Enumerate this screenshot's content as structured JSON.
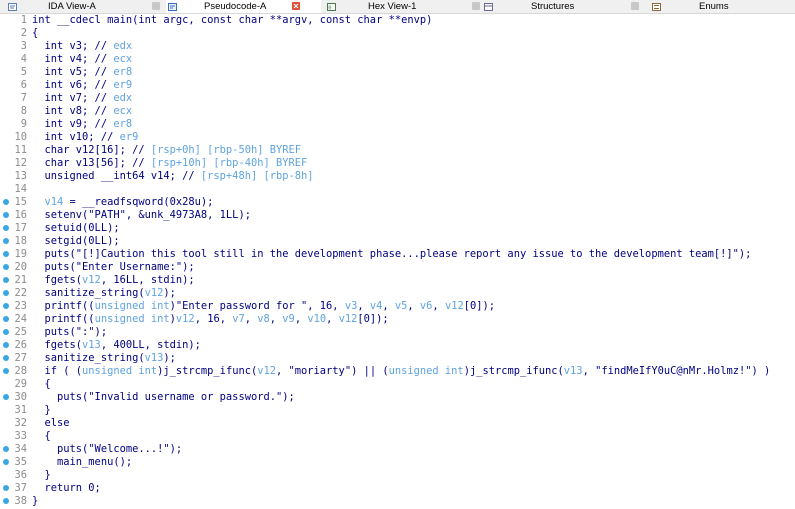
{
  "tabs": [
    {
      "label": "IDA View-A",
      "icon": "disassembly-icon",
      "active": false
    },
    {
      "label": "Pseudocode-A",
      "icon": "pseudocode-icon",
      "active": true
    },
    {
      "label": "Hex View-1",
      "icon": "hex-icon",
      "active": false
    },
    {
      "label": "Structures",
      "icon": "structures-icon",
      "active": false
    },
    {
      "label": "Enums",
      "icon": "enums-icon",
      "active": false
    }
  ],
  "colors": {
    "code_text": "#00007f",
    "comment": "#5fa3e0",
    "line_number": "#8c8c8c",
    "breakpoint_dot": "#3ba6e6",
    "close_button": "#e05030"
  },
  "code_lines": [
    {
      "n": "1",
      "dot": false,
      "parts": [
        [
          "int __cdecl main(int argc, const char **argv, const char **envp)",
          "t"
        ]
      ]
    },
    {
      "n": "2",
      "dot": false,
      "parts": [
        [
          "{",
          "t"
        ]
      ]
    },
    {
      "n": "3",
      "dot": false,
      "parts": [
        [
          "  int v3; // ",
          "t"
        ],
        [
          "edx",
          "c"
        ]
      ]
    },
    {
      "n": "4",
      "dot": false,
      "parts": [
        [
          "  int v4; // ",
          "t"
        ],
        [
          "ecx",
          "c"
        ]
      ]
    },
    {
      "n": "5",
      "dot": false,
      "parts": [
        [
          "  int v5; // ",
          "t"
        ],
        [
          "er8",
          "c"
        ]
      ]
    },
    {
      "n": "6",
      "dot": false,
      "parts": [
        [
          "  int v6; // ",
          "t"
        ],
        [
          "er9",
          "c"
        ]
      ]
    },
    {
      "n": "7",
      "dot": false,
      "parts": [
        [
          "  int v7; // ",
          "t"
        ],
        [
          "edx",
          "c"
        ]
      ]
    },
    {
      "n": "8",
      "dot": false,
      "parts": [
        [
          "  int v8; // ",
          "t"
        ],
        [
          "ecx",
          "c"
        ]
      ]
    },
    {
      "n": "9",
      "dot": false,
      "parts": [
        [
          "  int v9; // ",
          "t"
        ],
        [
          "er8",
          "c"
        ]
      ]
    },
    {
      "n": "10",
      "dot": false,
      "parts": [
        [
          "  int v10; // ",
          "t"
        ],
        [
          "er9",
          "c"
        ]
      ]
    },
    {
      "n": "11",
      "dot": false,
      "parts": [
        [
          "  char v12[16]; // ",
          "t"
        ],
        [
          "[rsp+0h] [rbp-50h] BYREF",
          "c"
        ]
      ]
    },
    {
      "n": "12",
      "dot": false,
      "parts": [
        [
          "  char v13[56]; // ",
          "t"
        ],
        [
          "[rsp+10h] [rbp-40h] BYREF",
          "c"
        ]
      ]
    },
    {
      "n": "13",
      "dot": false,
      "parts": [
        [
          "  unsigned __int64 v14; // ",
          "t"
        ],
        [
          "[rsp+48h] [rbp-8h]",
          "c"
        ]
      ]
    },
    {
      "n": "14",
      "dot": false,
      "parts": [
        [
          "",
          "t"
        ]
      ]
    },
    {
      "n": "15",
      "dot": true,
      "parts": [
        [
          "  ",
          "t"
        ],
        [
          "v14",
          "c"
        ],
        [
          " = __readfsqword(0x28u);",
          "t"
        ]
      ]
    },
    {
      "n": "16",
      "dot": true,
      "parts": [
        [
          "  setenv(\"PATH\", &unk_4973A8, 1LL);",
          "t"
        ]
      ]
    },
    {
      "n": "17",
      "dot": true,
      "parts": [
        [
          "  setuid(0LL);",
          "t"
        ]
      ]
    },
    {
      "n": "18",
      "dot": true,
      "parts": [
        [
          "  setgid(0LL);",
          "t"
        ]
      ]
    },
    {
      "n": "19",
      "dot": true,
      "parts": [
        [
          "  puts(\"[!]Caution this tool still in the development phase...please report any issue to the development team[!]\");",
          "t"
        ]
      ]
    },
    {
      "n": "20",
      "dot": true,
      "parts": [
        [
          "  puts(\"Enter Username:\");",
          "t"
        ]
      ]
    },
    {
      "n": "21",
      "dot": true,
      "parts": [
        [
          "  fgets(",
          "t"
        ],
        [
          "v12",
          "c"
        ],
        [
          ", 16LL, stdin);",
          "t"
        ]
      ]
    },
    {
      "n": "22",
      "dot": true,
      "parts": [
        [
          "  sanitize_string(",
          "t"
        ],
        [
          "v12",
          "c"
        ],
        [
          ");",
          "t"
        ]
      ]
    },
    {
      "n": "23",
      "dot": true,
      "parts": [
        [
          "  printf((",
          "t"
        ],
        [
          "unsigned int",
          "c"
        ],
        [
          ")\"Enter password for \", 16, ",
          "t"
        ],
        [
          "v3",
          "c"
        ],
        [
          ", ",
          "t"
        ],
        [
          "v4",
          "c"
        ],
        [
          ", ",
          "t"
        ],
        [
          "v5",
          "c"
        ],
        [
          ", ",
          "t"
        ],
        [
          "v6",
          "c"
        ],
        [
          ", ",
          "t"
        ],
        [
          "v12",
          "c"
        ],
        [
          "[0]);",
          "t"
        ]
      ]
    },
    {
      "n": "24",
      "dot": true,
      "parts": [
        [
          "  printf((",
          "t"
        ],
        [
          "unsigned int",
          "c"
        ],
        [
          ")",
          "t"
        ],
        [
          "v12",
          "c"
        ],
        [
          ", 16, ",
          "t"
        ],
        [
          "v7",
          "c"
        ],
        [
          ", ",
          "t"
        ],
        [
          "v8",
          "c"
        ],
        [
          ", ",
          "t"
        ],
        [
          "v9",
          "c"
        ],
        [
          ", ",
          "t"
        ],
        [
          "v10",
          "c"
        ],
        [
          ", ",
          "t"
        ],
        [
          "v12",
          "c"
        ],
        [
          "[0]);",
          "t"
        ]
      ]
    },
    {
      "n": "25",
      "dot": true,
      "parts": [
        [
          "  puts(\":\");",
          "t"
        ]
      ]
    },
    {
      "n": "26",
      "dot": true,
      "parts": [
        [
          "  fgets(",
          "t"
        ],
        [
          "v13",
          "c"
        ],
        [
          ", 400LL, stdin);",
          "t"
        ]
      ]
    },
    {
      "n": "27",
      "dot": true,
      "parts": [
        [
          "  sanitize_string(",
          "t"
        ],
        [
          "v13",
          "c"
        ],
        [
          ");",
          "t"
        ]
      ]
    },
    {
      "n": "28",
      "dot": true,
      "parts": [
        [
          "  if ( (",
          "t"
        ],
        [
          "unsigned int",
          "c"
        ],
        [
          ")j_strcmp_ifunc(",
          "t"
        ],
        [
          "v12",
          "c"
        ],
        [
          ", \"moriarty\") || (",
          "t"
        ],
        [
          "unsigned int",
          "c"
        ],
        [
          ")j_strcmp_ifunc(",
          "t"
        ],
        [
          "v13",
          "c"
        ],
        [
          ", \"findMeIfY0uC@nMr.Holmz!\") )",
          "t"
        ]
      ]
    },
    {
      "n": "29",
      "dot": false,
      "parts": [
        [
          "  {",
          "t"
        ]
      ]
    },
    {
      "n": "30",
      "dot": true,
      "parts": [
        [
          "    puts(\"Invalid username or password.\");",
          "t"
        ]
      ]
    },
    {
      "n": "31",
      "dot": false,
      "parts": [
        [
          "  }",
          "t"
        ]
      ]
    },
    {
      "n": "32",
      "dot": false,
      "parts": [
        [
          "  else",
          "t"
        ]
      ]
    },
    {
      "n": "33",
      "dot": false,
      "parts": [
        [
          "  {",
          "t"
        ]
      ]
    },
    {
      "n": "34",
      "dot": true,
      "parts": [
        [
          "    puts(\"Welcome...!\");",
          "t"
        ]
      ]
    },
    {
      "n": "35",
      "dot": true,
      "parts": [
        [
          "    main_menu();",
          "t"
        ]
      ]
    },
    {
      "n": "36",
      "dot": false,
      "parts": [
        [
          "  }",
          "t"
        ]
      ]
    },
    {
      "n": "37",
      "dot": true,
      "parts": [
        [
          "  return 0;",
          "t"
        ]
      ]
    },
    {
      "n": "38",
      "dot": true,
      "parts": [
        [
          "}",
          "t"
        ]
      ]
    }
  ]
}
